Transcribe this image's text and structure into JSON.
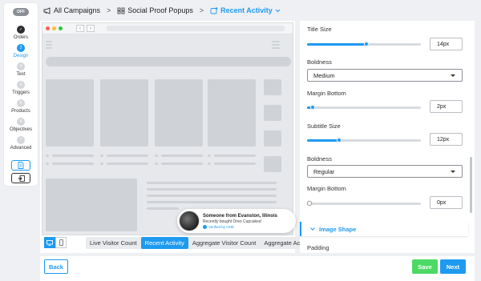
{
  "breadcrumb": {
    "items": [
      {
        "label": "All Campaigns",
        "icon": "megaphone-icon"
      },
      {
        "label": "Social Proof Popups",
        "icon": "grid-icon"
      },
      {
        "label": "Recent Activity",
        "icon": "recent-activity-icon"
      }
    ],
    "separator": ">"
  },
  "sidebar": {
    "toggle_label": "OFF",
    "steps": [
      {
        "num": "✓",
        "label": "Orders",
        "state": "done"
      },
      {
        "num": "2",
        "label": "Design",
        "state": "current"
      },
      {
        "num": "3",
        "label": "Text",
        "state": "todo"
      },
      {
        "num": "4",
        "label": "Triggers",
        "state": "todo"
      },
      {
        "num": "5",
        "label": "Products",
        "state": "todo"
      },
      {
        "num": "6",
        "label": "Objectives",
        "state": "todo"
      },
      {
        "num": "7",
        "label": "Advanced",
        "state": "todo"
      }
    ]
  },
  "notification": {
    "title": "Someone from Evanston, Illinois",
    "subtitle": "Recently bought Oreo Cupcakes!",
    "verified": "Verified by OHE"
  },
  "preview_tabs": {
    "items": [
      "Live Visitor Count",
      "Recent Activity",
      "Aggregate Visitor Count",
      "Aggregate Activity"
    ],
    "active": "Recent Activity"
  },
  "settings": {
    "title_size": {
      "label": "Title Size",
      "value": "14px",
      "fraction": 0.52
    },
    "boldness_1": {
      "label": "Boldness",
      "value": "Medium"
    },
    "margin_bottom_1": {
      "label": "Margin Bottom",
      "value": "2px",
      "fraction": 0.05
    },
    "subtitle_size": {
      "label": "Subtitle Size",
      "value": "12px",
      "fraction": 0.28
    },
    "boldness_2": {
      "label": "Boldness",
      "value": "Regular"
    },
    "margin_bottom_2": {
      "label": "Margin Bottom",
      "value": "0px",
      "fraction": 0.0
    },
    "section_image_shape": "Image Shape",
    "padding_label": "Padding"
  },
  "footer": {
    "back": "Back",
    "save": "Save",
    "next": "Next"
  },
  "colors": {
    "accent": "#1e9af0",
    "save": "#4cd964",
    "dark_step": "#2b2d30"
  }
}
